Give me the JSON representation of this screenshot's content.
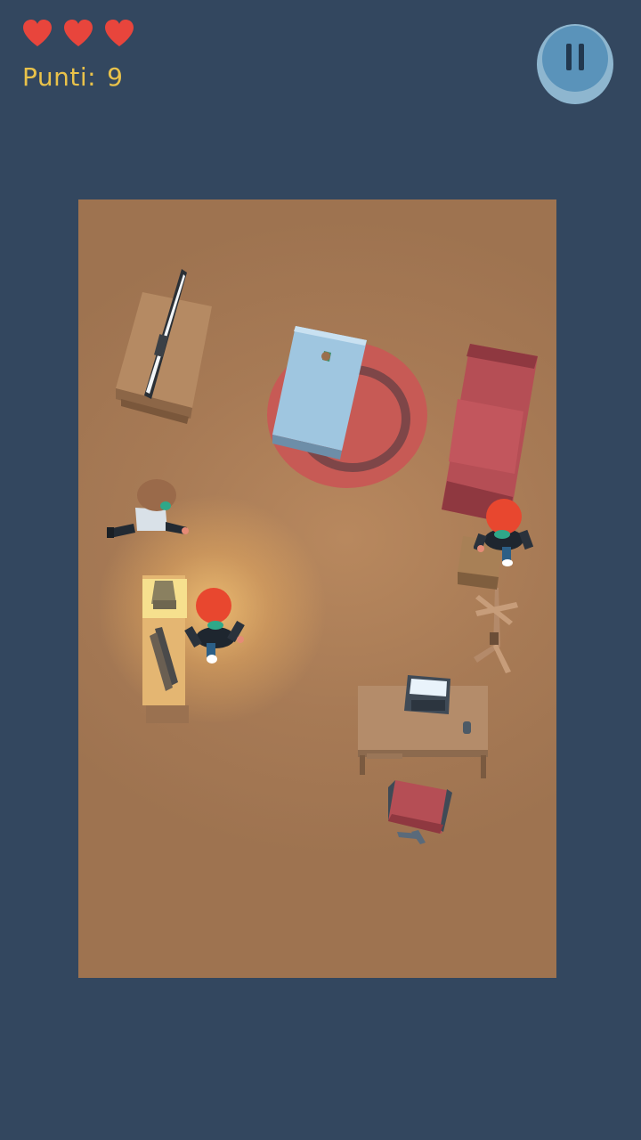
{
  "hud": {
    "lives": 3,
    "score_label": "Punti:",
    "score_value": "9",
    "heart_color": "#e8453c",
    "score_color": "#e9c24a"
  },
  "pause_button": {
    "icon": "pause-icon"
  },
  "colors": {
    "background": "#33475f",
    "floor": "#a77a55",
    "sofa": "#b54e55",
    "rug": "#c75a55",
    "table_glass": "#9fc6e0",
    "player_hair": "#e8472f"
  }
}
